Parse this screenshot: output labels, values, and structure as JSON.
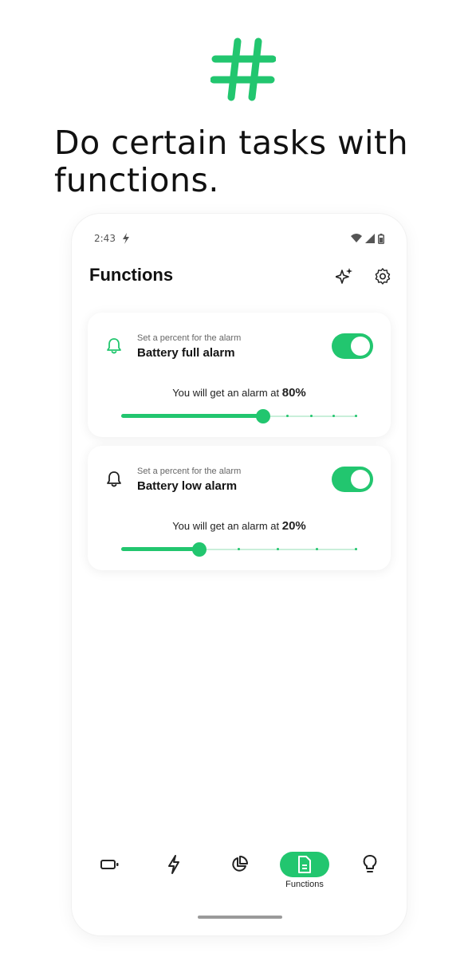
{
  "headline": "Do certain tasks with functions.",
  "brand_color": "#22c66f",
  "status_bar": {
    "time": "2:43",
    "icons": [
      "lightning-icon",
      "wifi-icon",
      "signal-icon",
      "battery-icon"
    ]
  },
  "appbar": {
    "title": "Functions",
    "actions": [
      "sparkle-icon",
      "gear-icon"
    ]
  },
  "cards": [
    {
      "subtitle": "Set a percent for the alarm",
      "title": "Battery full alarm",
      "enabled": true,
      "alarm_prefix": "You will get an alarm at ",
      "alarm_value": "80%",
      "slider_value": 0.6
    },
    {
      "subtitle": "Set a percent for the alarm",
      "title": "Battery low alarm",
      "enabled": true,
      "alarm_prefix": "You will get an alarm at ",
      "alarm_value": "20%",
      "slider_value": 0.33
    }
  ],
  "bottom_nav": {
    "items": [
      {
        "icon": "battery-icon"
      },
      {
        "icon": "lightning-icon"
      },
      {
        "icon": "pie-chart-icon"
      },
      {
        "icon": "document-icon",
        "label": "Functions",
        "active": true
      },
      {
        "icon": "lightbulb-icon"
      }
    ]
  }
}
